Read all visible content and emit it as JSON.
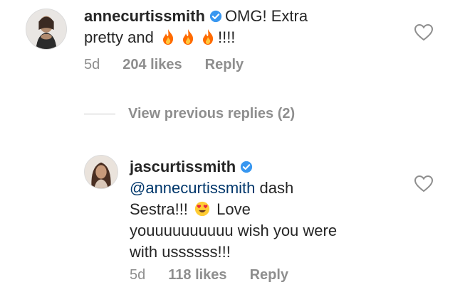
{
  "comment": {
    "username": "annecurtissmith",
    "text_start": "OMG! Extra",
    "text_line2_start": "pretty and",
    "fire_emojis": [
      "fire-emoji",
      "fire-emoji",
      "fire-emoji"
    ],
    "text_end": "!!!!",
    "time": "5d",
    "likes": "204 likes",
    "reply_label": "Reply"
  },
  "view_previous_replies": "View previous replies (2)",
  "reply": {
    "username": "jascurtissmith",
    "mention": "@annecurtissmith",
    "text_after_mention": " dash",
    "line2_start": "Sestra!!!",
    "emoji": "heart-eyes-emoji",
    "line2_end": "Love",
    "line3": "youuuuuuuuuu wish you were",
    "line4": "with ussssss!!!",
    "time": "5d",
    "likes": "118 likes",
    "reply_label": "Reply"
  },
  "colors": {
    "text": "#262626",
    "meta": "#8e8e8e",
    "mention": "#00376b",
    "verified": "#3897f0",
    "fire": "#ff6a00"
  }
}
